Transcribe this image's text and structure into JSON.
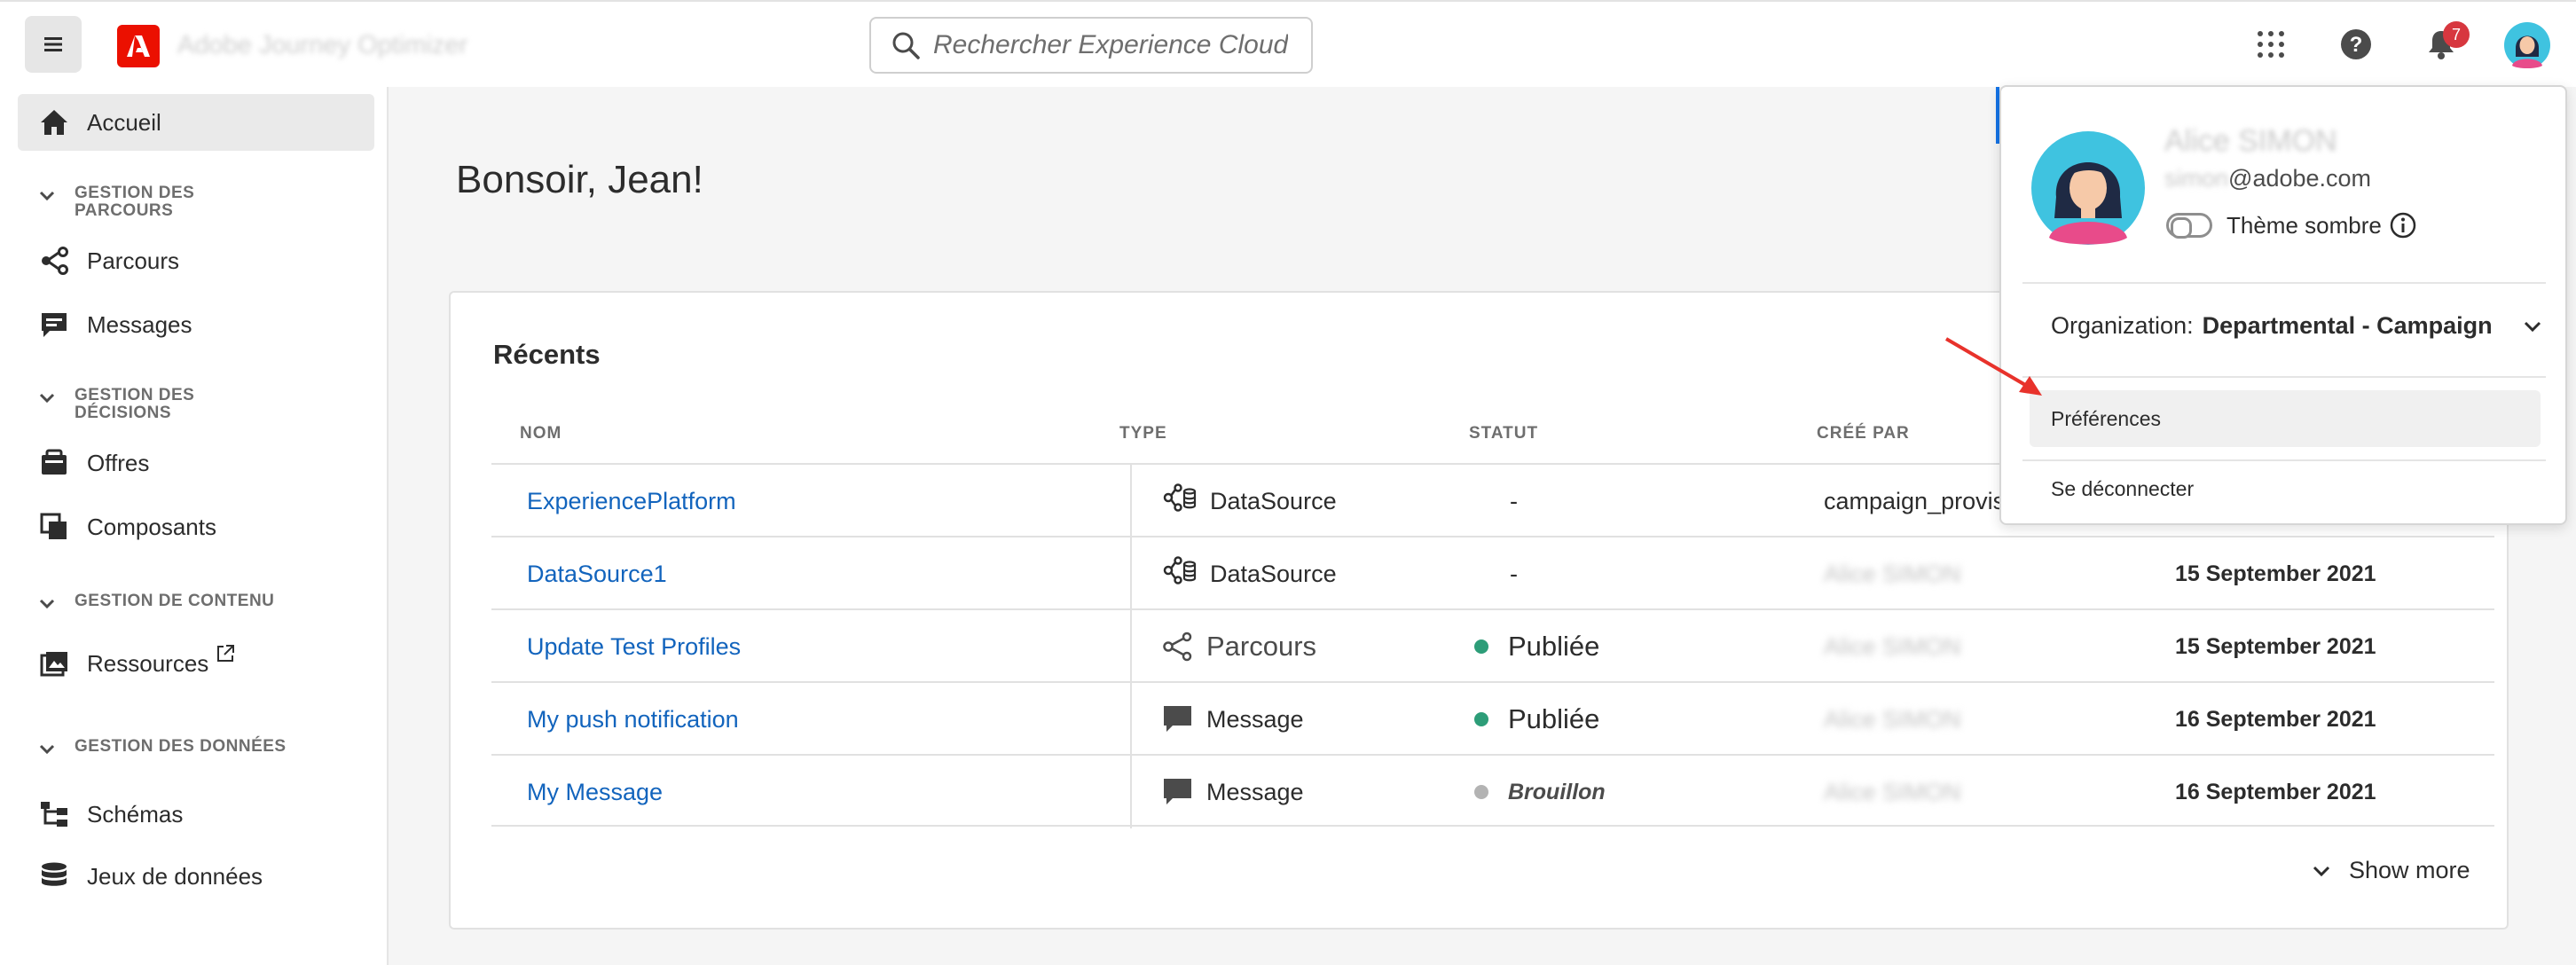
{
  "header": {
    "app_title": "Adobe Journey Optimizer",
    "search_placeholder": "Rechercher Experience Cloud",
    "notification_count": "7"
  },
  "sidebar": {
    "items": [
      {
        "label": "Accueil",
        "icon": "home-icon",
        "active": true
      },
      {
        "label": "Parcours",
        "icon": "journey-icon"
      },
      {
        "label": "Messages",
        "icon": "message-icon"
      },
      {
        "label": "Offres",
        "icon": "offers-icon"
      },
      {
        "label": "Composants",
        "icon": "components-icon"
      },
      {
        "label": "Ressources",
        "icon": "assets-icon"
      },
      {
        "label": "Schémas",
        "icon": "schema-icon"
      },
      {
        "label": "Jeux de données",
        "icon": "datasets-icon"
      }
    ],
    "sections": {
      "journeys_line1": "GESTION DES",
      "journeys_line2": "PARCOURS",
      "decisions_line1": "GESTION DES",
      "decisions_line2": "DÉCISIONS",
      "content": "GESTION DE CONTENU",
      "data": "GESTION DES DONNÉES"
    }
  },
  "main": {
    "greeting": "Bonsoir, Jean!",
    "recents": {
      "title": "Récents",
      "columns": [
        "NOM",
        "TYPE",
        "STATUT",
        "CRÉÉ PAR"
      ],
      "rows": [
        {
          "name": "ExperiencePlatform",
          "type": "DataSource",
          "status": "-",
          "creator": "campaign_provisi",
          "date": ""
        },
        {
          "name": "DataSource1",
          "type": "DataSource",
          "status": "-",
          "creator": "Alice SIMON",
          "date": "15 September 2021"
        },
        {
          "name": "Update Test Profiles",
          "type": "Parcours",
          "status": "Publiée",
          "creator": "Alice SIMON",
          "date": "15 September 2021"
        },
        {
          "name": "My push notification",
          "type": "Message",
          "status": "Publiée",
          "creator": "Alice SIMON",
          "date": "16 September 2021"
        },
        {
          "name": "My Message",
          "type": "Message",
          "status": "Brouillon",
          "creator": "Alice SIMON",
          "date": "16 September 2021"
        }
      ],
      "show_more": "Show more"
    }
  },
  "profile_menu": {
    "name": "Alice SIMON",
    "email_hidden": "simon",
    "email_domain": "@adobe.com",
    "dark_theme_label": "Thème sombre",
    "dark_theme_on": false,
    "org_label": "Organization:",
    "org_value": "Departmental - Campaign",
    "preferences": "Préférences",
    "logout": "Se déconnecter"
  },
  "colors": {
    "accent": "#1473e6",
    "link": "#1264bd",
    "adobe_red": "#eb1000",
    "published": "#2d9d78",
    "draft": "#b3b3b3",
    "annotation_arrow": "#e8322b"
  }
}
